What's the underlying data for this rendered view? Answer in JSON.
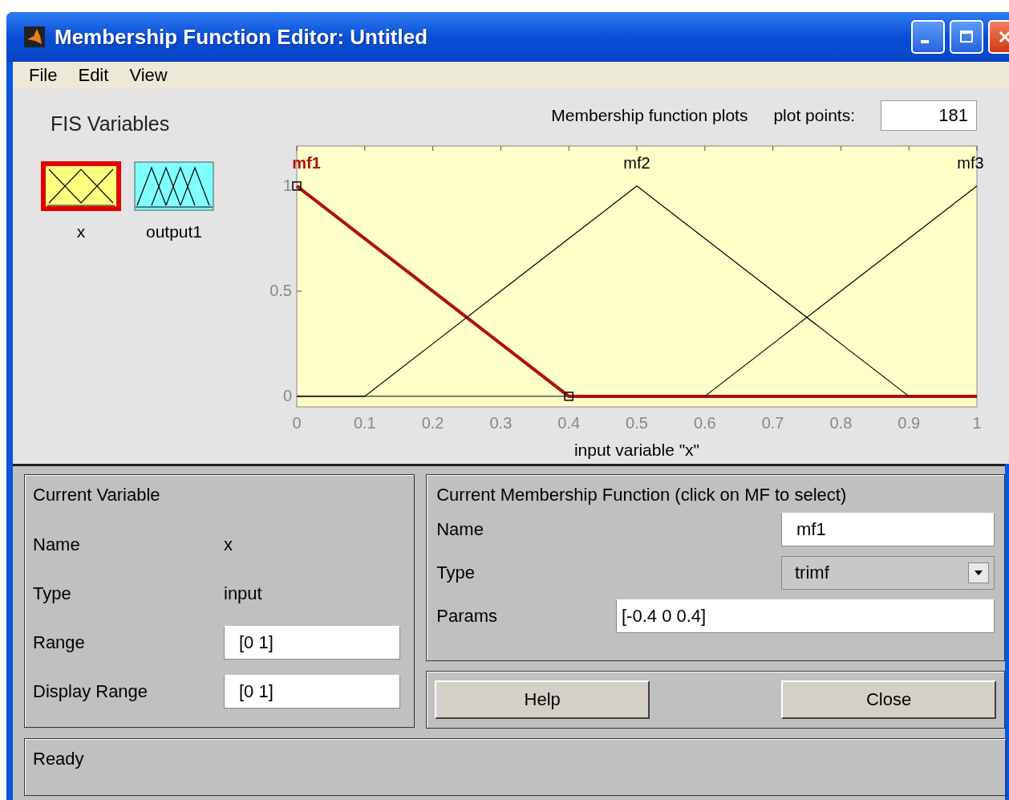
{
  "window": {
    "title": "Membership Function Editor: Untitled"
  },
  "menu": [
    "File",
    "Edit",
    "View"
  ],
  "fis_variables": {
    "title": "FIS Variables",
    "items": [
      {
        "label": "x",
        "kind": "input",
        "selected": true
      },
      {
        "label": "output1",
        "kind": "output",
        "selected": false
      }
    ]
  },
  "plot": {
    "title": "Membership function plots",
    "plot_points_label": "plot points:",
    "plot_points": "181",
    "chart_data": {
      "type": "line",
      "xlabel": "input variable \"x\"",
      "x": [
        0,
        0.1,
        0.2,
        0.3,
        0.4,
        0.5,
        0.6,
        0.7,
        0.8,
        0.9,
        1
      ],
      "xlim": [
        0,
        1
      ],
      "ylim": [
        -0.05,
        1.19
      ],
      "xticks": [
        0,
        0.1,
        0.2,
        0.3,
        0.4,
        0.5,
        0.6,
        0.7,
        0.8,
        0.9,
        1
      ],
      "yticks": [
        0,
        0.5,
        1
      ],
      "series": [
        {
          "name": "mf1",
          "color": "#b01010",
          "values": [
            1,
            0.75,
            0.5,
            0.25,
            0,
            0,
            0,
            0,
            0,
            0,
            0
          ]
        },
        {
          "name": "mf2",
          "color": "#000000",
          "values": [
            0,
            0,
            0.25,
            0.5,
            0.75,
            1,
            0.75,
            0.5,
            0.25,
            0,
            null
          ]
        },
        {
          "name": "mf3",
          "color": "#000000",
          "values": [
            null,
            null,
            null,
            null,
            null,
            null,
            0,
            0.25,
            0.5,
            0.75,
            1
          ]
        }
      ]
    },
    "curves": [
      {
        "selected": true
      },
      {
        "selected": false
      },
      {
        "selected": false
      }
    ]
  },
  "current_variable": {
    "title": "Current Variable",
    "name_label": "Name",
    "name": "x",
    "type_label": "Type",
    "type": "input",
    "range_label": "Range",
    "range": "[0 1]",
    "display_range_label": "Display Range",
    "display_range": "[0 1]"
  },
  "current_mf": {
    "title": "Current Membership Function (click on MF to select)",
    "name_label": "Name",
    "name": "mf1",
    "type_label": "Type",
    "type": "trimf",
    "params_label": "Params",
    "params": "[-0.4 0 0.4]"
  },
  "buttons": [
    "Help",
    "Close"
  ],
  "status": "Ready"
}
